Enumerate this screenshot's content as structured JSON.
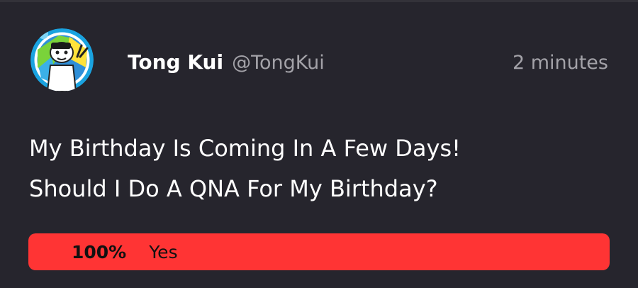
{
  "post": {
    "author": {
      "display_name": "Tong Kui",
      "handle": "@TongKui",
      "avatar_icon": "cartoon-avatar-icon"
    },
    "timestamp": "2 minutes",
    "text_lines": [
      "My Birthday Is Coming In A Few Days!",
      "Should I Do A QNA For My Birthday?"
    ]
  },
  "poll": {
    "options": [
      {
        "percent_label": "100%",
        "percent_value": 100,
        "label": "Yes"
      }
    ],
    "colors": {
      "fill": "#ff3434",
      "track": "#3a3941"
    }
  },
  "colors": {
    "background": "#26252d",
    "text": "#ffffff",
    "muted_text": "#a3a2a8"
  }
}
